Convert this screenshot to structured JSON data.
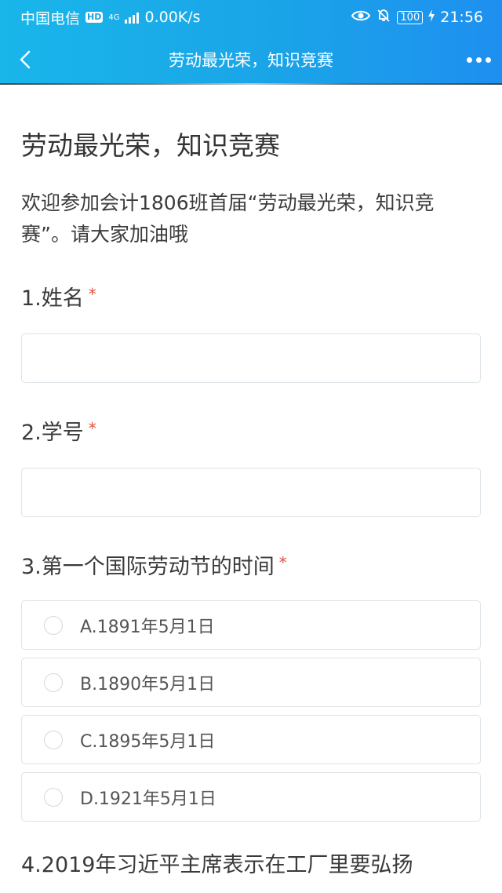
{
  "status_bar": {
    "carrier": "中国电信",
    "hd": "HD",
    "network": "4G",
    "speed": "0.00K/s",
    "battery": "100",
    "time": "21:56"
  },
  "nav": {
    "title": "劳动最光荣，知识竞赛",
    "back_icon": "chevron-left-icon",
    "more_icon": "more-dots-icon"
  },
  "form": {
    "title": "劳动最光荣，知识竞赛",
    "description": "欢迎参加会计1806班首届“劳动最光荣，知识竞赛”。请大家加油哦",
    "required_mark": "*",
    "questions": [
      {
        "label": "1.姓名",
        "value": ""
      },
      {
        "label": "2.学号",
        "value": ""
      },
      {
        "label": "3.第一个国际劳动节的时间",
        "options": [
          "A.1891年5月1日",
          "B.1890年5月1日",
          "C.1895年5月1日",
          "D.1921年5月1日"
        ]
      },
      {
        "label": "4.2019年习近平主席表示在工厂里要弘扬"
      }
    ]
  },
  "colors": {
    "header_start": "#19b6ea",
    "header_end": "#1e8ff0",
    "required": "#e0533f",
    "border": "#dde3e8"
  }
}
